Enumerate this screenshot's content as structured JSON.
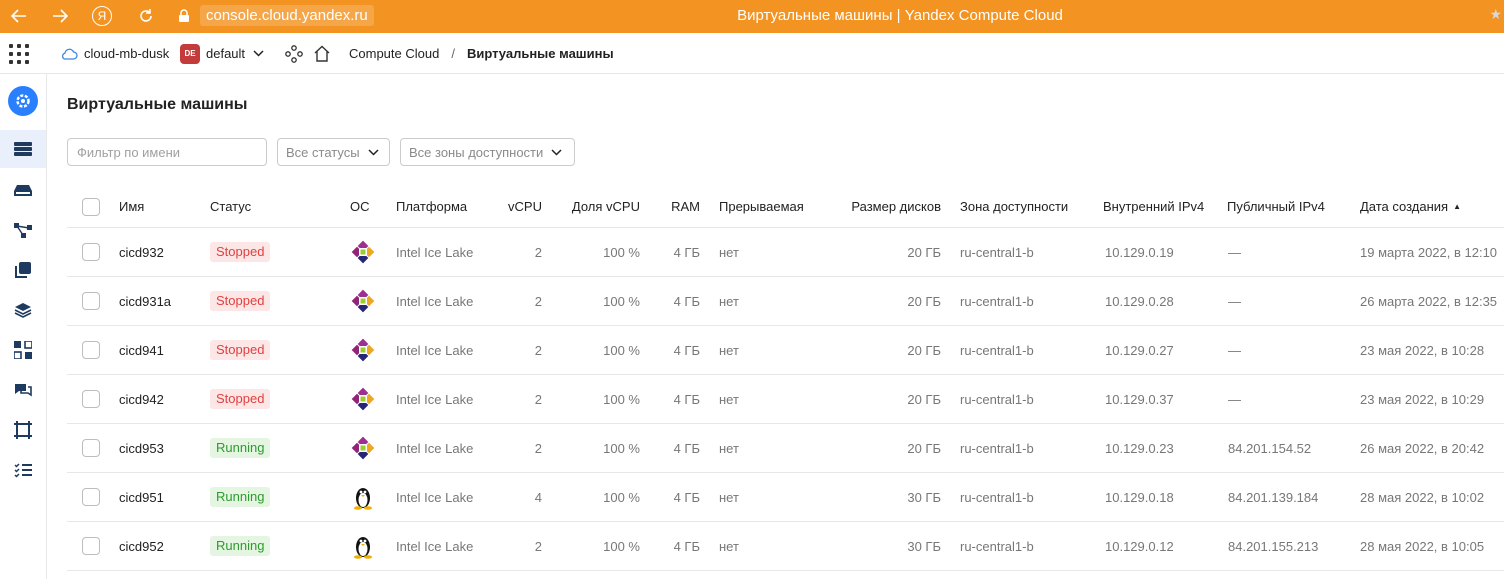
{
  "browser": {
    "url": "console.cloud.yandex.ru",
    "title": "Виртуальные машины | Yandex Compute Cloud",
    "yandex_glyph": "Я"
  },
  "header": {
    "cloud": "cloud-mb-dusk",
    "folder_badge": "DE",
    "folder": "default",
    "service": "Compute Cloud",
    "separator": "/",
    "current": "Виртуальные машины"
  },
  "page": {
    "title": "Виртуальные машины",
    "filter_placeholder": "Фильтр по имени",
    "status_filter": "Все статусы",
    "zone_filter": "Все зоны доступности"
  },
  "table": {
    "columns": {
      "name": "Имя",
      "status": "Статус",
      "os": "ОС",
      "platform": "Платформа",
      "vcpu": "vCPU",
      "vcpu_share": "Доля vCPU",
      "ram": "RAM",
      "preemptible": "Прерываемая",
      "disk": "Размер дисков",
      "zone": "Зона доступности",
      "ipv4_internal": "Внутренний IPv4",
      "ipv4_public": "Публичный IPv4",
      "created": "Дата создания",
      "sort_indicator": "▲"
    },
    "rows": [
      {
        "name": "cicd932",
        "status": "Stopped",
        "os": "centos",
        "platform": "Intel Ice Lake",
        "vcpu": "2",
        "vcpu_share": "100 %",
        "ram": "4 ГБ",
        "preemptible": "нет",
        "disk": "20 ГБ",
        "zone": "ru-central1-b",
        "ipv4_internal": "10.129.0.19",
        "ipv4_public": "—",
        "created": "19 марта 2022, в 12:10"
      },
      {
        "name": "cicd931a",
        "status": "Stopped",
        "os": "centos",
        "platform": "Intel Ice Lake",
        "vcpu": "2",
        "vcpu_share": "100 %",
        "ram": "4 ГБ",
        "preemptible": "нет",
        "disk": "20 ГБ",
        "zone": "ru-central1-b",
        "ipv4_internal": "10.129.0.28",
        "ipv4_public": "—",
        "created": "26 марта 2022, в 12:35"
      },
      {
        "name": "cicd941",
        "status": "Stopped",
        "os": "centos",
        "platform": "Intel Ice Lake",
        "vcpu": "2",
        "vcpu_share": "100 %",
        "ram": "4 ГБ",
        "preemptible": "нет",
        "disk": "20 ГБ",
        "zone": "ru-central1-b",
        "ipv4_internal": "10.129.0.27",
        "ipv4_public": "—",
        "created": "23 мая 2022, в 10:28"
      },
      {
        "name": "cicd942",
        "status": "Stopped",
        "os": "centos",
        "platform": "Intel Ice Lake",
        "vcpu": "2",
        "vcpu_share": "100 %",
        "ram": "4 ГБ",
        "preemptible": "нет",
        "disk": "20 ГБ",
        "zone": "ru-central1-b",
        "ipv4_internal": "10.129.0.37",
        "ipv4_public": "—",
        "created": "23 мая 2022, в 10:29"
      },
      {
        "name": "cicd953",
        "status": "Running",
        "os": "centos",
        "platform": "Intel Ice Lake",
        "vcpu": "2",
        "vcpu_share": "100 %",
        "ram": "4 ГБ",
        "preemptible": "нет",
        "disk": "20 ГБ",
        "zone": "ru-central1-b",
        "ipv4_internal": "10.129.0.23",
        "ipv4_public": "84.201.154.52",
        "created": "26 мая 2022, в 20:42"
      },
      {
        "name": "cicd951",
        "status": "Running",
        "os": "linux",
        "platform": "Intel Ice Lake",
        "vcpu": "4",
        "vcpu_share": "100 %",
        "ram": "4 ГБ",
        "preemptible": "нет",
        "disk": "30 ГБ",
        "zone": "ru-central1-b",
        "ipv4_internal": "10.129.0.18",
        "ipv4_public": "84.201.139.184",
        "created": "28 мая 2022, в 10:02"
      },
      {
        "name": "cicd952",
        "status": "Running",
        "os": "linux",
        "platform": "Intel Ice Lake",
        "vcpu": "2",
        "vcpu_share": "100 %",
        "ram": "4 ГБ",
        "preemptible": "нет",
        "disk": "30 ГБ",
        "zone": "ru-central1-b",
        "ipv4_internal": "10.129.0.12",
        "ipv4_public": "84.201.155.213",
        "created": "28 мая 2022, в 10:05"
      }
    ]
  },
  "colors": {
    "browser_bar": "#f39322",
    "accent": "#2a7fff",
    "stopped": "#e04040",
    "running": "#2f9a2f"
  }
}
